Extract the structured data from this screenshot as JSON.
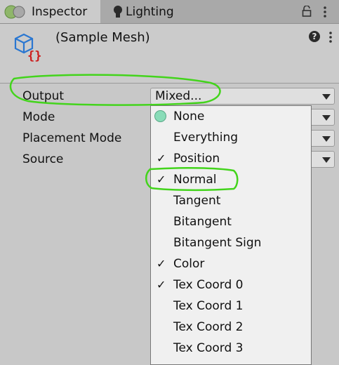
{
  "tabs": [
    {
      "label": "Inspector",
      "icon": "inspector-dot-icon",
      "active": true
    },
    {
      "label": "Lighting",
      "icon": "lightbulb-icon",
      "active": false
    }
  ],
  "tabbar_icons": [
    "lock-icon",
    "kebab-menu-icon"
  ],
  "header": {
    "title": "(Sample Mesh)",
    "icon": "mesh-cube-icon",
    "help_label": "?"
  },
  "properties": [
    {
      "label": "Output",
      "value": "Mixed..."
    },
    {
      "label": "Mode",
      "value": ""
    },
    {
      "label": "Placement Mode",
      "value": ""
    },
    {
      "label": "Source",
      "value": ""
    }
  ],
  "dropdown": {
    "options": [
      {
        "label": "None",
        "checked": false,
        "hovered": true
      },
      {
        "label": "Everything",
        "checked": false
      },
      {
        "label": "Position",
        "checked": true
      },
      {
        "label": "Normal",
        "checked": true
      },
      {
        "label": "Tangent",
        "checked": false
      },
      {
        "label": "Bitangent",
        "checked": false
      },
      {
        "label": "Bitangent Sign",
        "checked": false
      },
      {
        "label": "Color",
        "checked": true
      },
      {
        "label": "Tex Coord 0",
        "checked": true
      },
      {
        "label": "Tex Coord 1",
        "checked": false
      },
      {
        "label": "Tex Coord 2",
        "checked": false
      },
      {
        "label": "Tex Coord 3",
        "checked": false
      }
    ],
    "check_glyph": "✓"
  },
  "annotations": {
    "color": "#43d41c"
  },
  "colors": {
    "hover_dot": "#89dcb8",
    "panel_bg": "#cbcbcb",
    "tabbar_bg": "#a9a9a9"
  }
}
